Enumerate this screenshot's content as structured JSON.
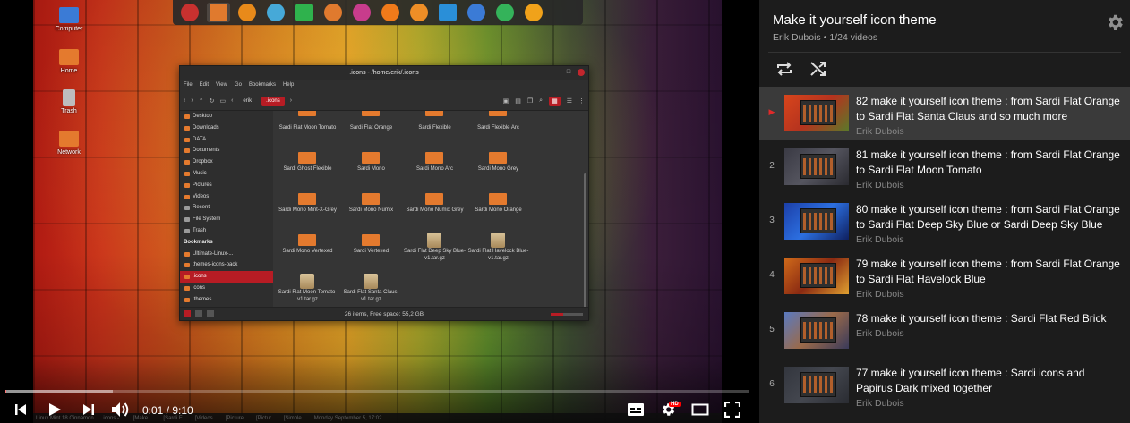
{
  "desktop": {
    "icons": [
      {
        "label": "Computer"
      },
      {
        "label": "Home"
      },
      {
        "label": "Trash"
      },
      {
        "label": "Network"
      }
    ],
    "dock_colors": [
      "#c8312f",
      "#e07a2e",
      "#e88a1a",
      "#46a9d8",
      "#2fb24d",
      "#e07a2e",
      "#c83c8c",
      "#f07a1a",
      "#ee8e26",
      "#2a8fd8",
      "#3b7bd6",
      "#34b35a",
      "#f0a21a"
    ]
  },
  "file_manager": {
    "title": ".icons - /home/erik/.icons",
    "menu": [
      "File",
      "Edit",
      "View",
      "Go",
      "Bookmarks",
      "Help"
    ],
    "breadcrumbs": [
      "erik",
      ".icons"
    ],
    "sidebar": [
      {
        "label": "Desktop",
        "type": "place"
      },
      {
        "label": "Downloads",
        "type": "place"
      },
      {
        "label": "DATA",
        "type": "place"
      },
      {
        "label": "Documents",
        "type": "place"
      },
      {
        "label": "Dropbox",
        "type": "place"
      },
      {
        "label": "Music",
        "type": "place"
      },
      {
        "label": "Pictures",
        "type": "place"
      },
      {
        "label": "Videos",
        "type": "place"
      },
      {
        "label": "Recent",
        "type": "grey"
      },
      {
        "label": "File System",
        "type": "grey"
      },
      {
        "label": "Trash",
        "type": "grey"
      },
      {
        "label": "Bookmarks",
        "type": "head"
      },
      {
        "label": "Ultimate-Linux-...",
        "type": "place"
      },
      {
        "label": "themes-icons-pack",
        "type": "place"
      },
      {
        "label": ".icons",
        "type": "selected"
      },
      {
        "label": "icons",
        "type": "place"
      },
      {
        "label": ".themes",
        "type": "place"
      }
    ],
    "files": [
      {
        "name": "Sardi Flat Moon Tomato",
        "kind": "folder"
      },
      {
        "name": "Sardi Flat Orange",
        "kind": "folder"
      },
      {
        "name": "Sardi Flexible",
        "kind": "folder"
      },
      {
        "name": "Sardi Flexible Arc",
        "kind": "folder"
      },
      {
        "name": "Sardi Ghost Flexible",
        "kind": "folder"
      },
      {
        "name": "Sardi Mono",
        "kind": "folder"
      },
      {
        "name": "Sardi Mono Arc",
        "kind": "folder"
      },
      {
        "name": "Sardi Mono Grey",
        "kind": "folder"
      },
      {
        "name": "Sardi Mono Mint-X-Grey",
        "kind": "folder"
      },
      {
        "name": "Sardi Mono Numix",
        "kind": "folder"
      },
      {
        "name": "Sardi Mono Numix Grey",
        "kind": "folder"
      },
      {
        "name": "Sardi Mono Orange",
        "kind": "folder"
      },
      {
        "name": "Sardi Mono Vertexed",
        "kind": "folder"
      },
      {
        "name": "Sardi Vertexed",
        "kind": "folder"
      },
      {
        "name": "Sardi Flat Deep Sky Blue-v1.tar.gz",
        "kind": "archive"
      },
      {
        "name": "Sardi Flat Havelock Blue-v1.tar.gz",
        "kind": "archive"
      },
      {
        "name": "Sardi Flat Moon Tomato-v1.tar.gz",
        "kind": "archive"
      },
      {
        "name": "Sardi Flat Santa Claus-v1.tar.gz",
        "kind": "archive"
      }
    ],
    "status": "26 items, Free space: 55,2 GB"
  },
  "taskbar": {
    "items": [
      "Linux Mint 18 Cinnamon",
      ".icons - ...",
      "[Make I...",
      "[Sardi E...",
      "[Videos...",
      "[Picture...",
      "[Pictur...",
      "[Simple...",
      "Monday September 5, 17:02"
    ]
  },
  "player": {
    "current_time": "0:01",
    "separator": " / ",
    "duration": "9:10",
    "progress_fraction": 0.0018,
    "hd_badge": "HD"
  },
  "playlist": {
    "title": "Make it yourself icon theme",
    "author": "Erik Dubois",
    "position": "1/24 videos",
    "accent": "#e02a2a",
    "items": [
      {
        "index": "▶",
        "title": "82 make it yourself icon theme : from Sardi Flat Orange to Sardi Flat Santa Claus and so much more",
        "author": "Erik Dubois",
        "current": true,
        "thumb": [
          "#d8451c",
          "#b5331e",
          "#5a7a2a"
        ]
      },
      {
        "index": "2",
        "title": "81 make it yourself icon theme : from Sardi Flat Orange to Sardi Flat Moon Tomato",
        "author": "Erik Dubois",
        "current": false,
        "thumb": [
          "#3a3a44",
          "#55555f",
          "#2a2a30"
        ]
      },
      {
        "index": "3",
        "title": "80 make it yourself icon theme : from Sardi Flat Orange to Sardi Flat Deep Sky Blue or Sardi Deep Sky Blue",
        "author": "Erik Dubois",
        "current": false,
        "thumb": [
          "#1c3fa8",
          "#2c6fe0",
          "#0f2060"
        ]
      },
      {
        "index": "4",
        "title": "79 make it yourself icon theme : from Sardi Flat Orange to Sardi Flat Havelock Blue",
        "author": "Erik Dubois",
        "current": false,
        "thumb": [
          "#d06a1a",
          "#8a2a12",
          "#e0a030"
        ]
      },
      {
        "index": "5",
        "title": "78 make it yourself icon theme : Sardi Flat Red Brick",
        "author": "Erik Dubois",
        "current": false,
        "thumb": [
          "#5a7ac0",
          "#9a6a4a",
          "#3a3a5a"
        ]
      },
      {
        "index": "6",
        "title": "77 make it yourself icon theme : Sardi icons and Papirus Dark mixed together",
        "author": "Erik Dubois",
        "current": false,
        "thumb": [
          "#33363e",
          "#44474f",
          "#2a2c32"
        ]
      }
    ]
  }
}
